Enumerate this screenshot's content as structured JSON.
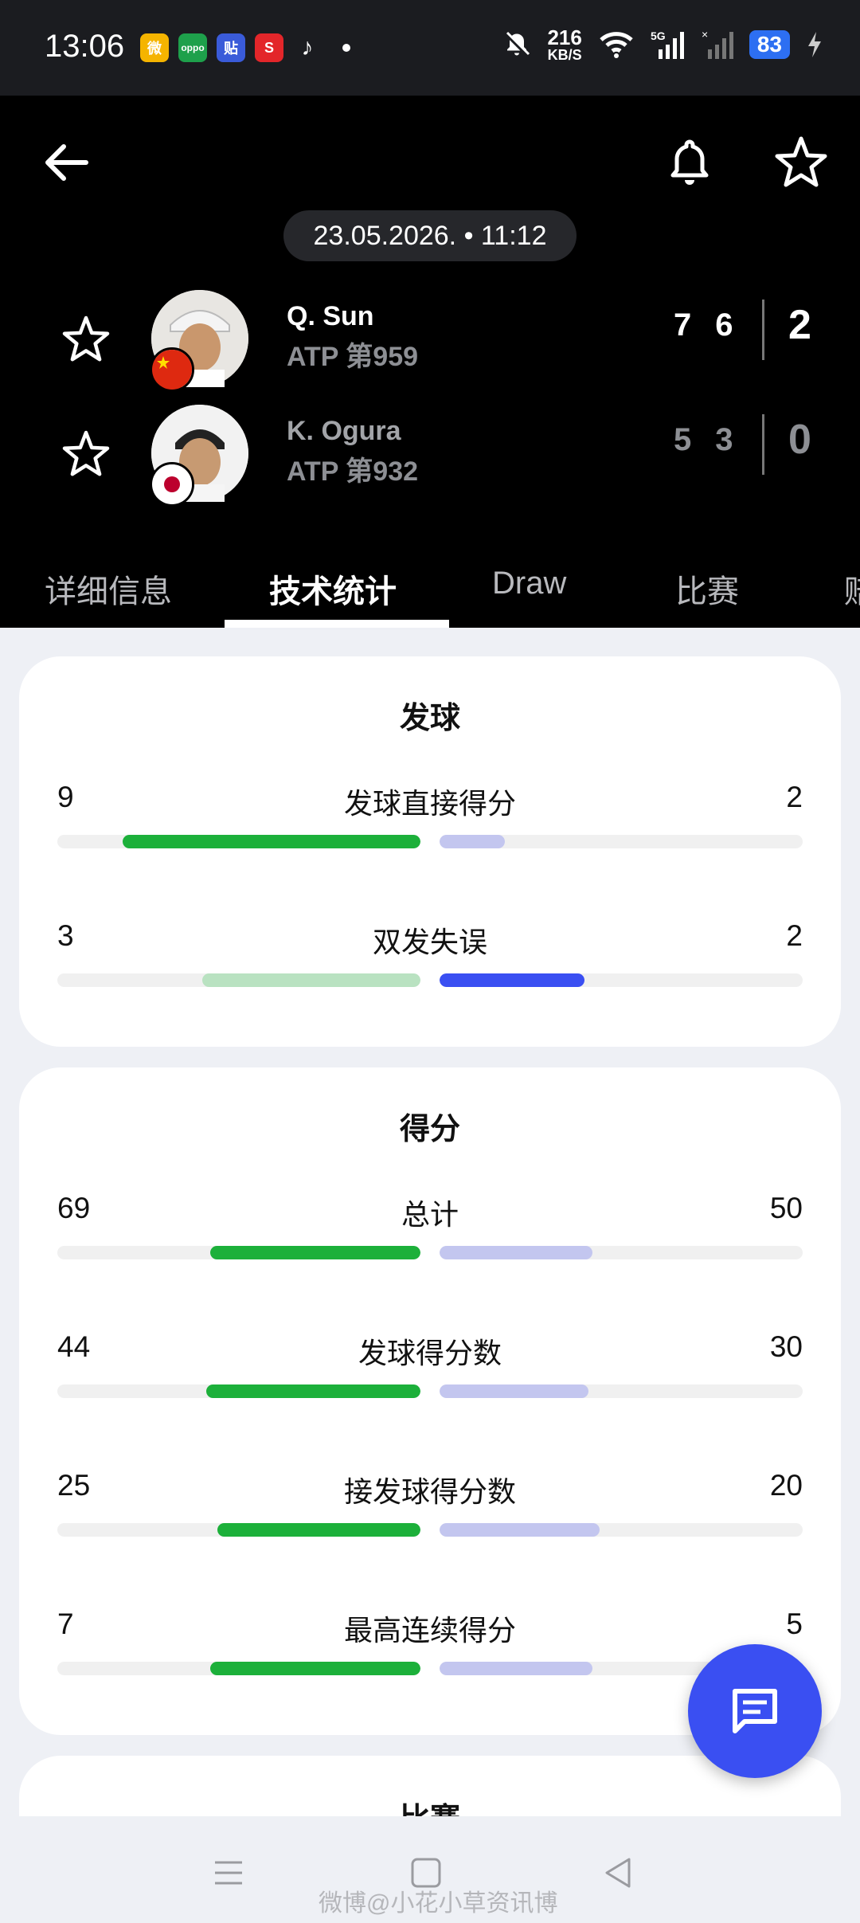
{
  "status_bar": {
    "time": "13:06",
    "speed_value": "216",
    "speed_unit": "KB/S",
    "network": "5G",
    "battery": "83",
    "apps": [
      "weibo-icon",
      "oppo-app-icon",
      "tieba-icon",
      "toutiao-icon",
      "tiktok-icon"
    ]
  },
  "header": {
    "datetime": "23.05.2026. • 11:12",
    "players": [
      {
        "name": "Q. Sun",
        "rank": "ATP 第959",
        "sets": [
          "7",
          "6"
        ],
        "total": "2",
        "flag": "china-flag-icon",
        "winner": true
      },
      {
        "name": "K. Ogura",
        "rank": "ATP 第932",
        "sets": [
          "5",
          "3"
        ],
        "total": "0",
        "flag": "japan-flag-icon",
        "winner": false
      }
    ],
    "tabs": [
      "详细信息",
      "技术统计",
      "Draw",
      "比赛",
      "赔"
    ],
    "active_tab": "技术统计"
  },
  "serve_card": {
    "title": "发球",
    "stats": [
      {
        "label": "发球直接得分",
        "left": "9",
        "right": "2",
        "left_pct": 82,
        "right_pct": 18,
        "left_color": "#1cb03a",
        "right_color": "#c3c6ef"
      },
      {
        "label": "双发失误",
        "left": "3",
        "right": "2",
        "left_pct": 60,
        "right_pct": 40,
        "left_color": "#b9e2c1",
        "right_color": "#3a4ff2"
      }
    ]
  },
  "points_card": {
    "title": "得分",
    "stats": [
      {
        "label": "总计",
        "left": "69",
        "right": "50",
        "left_pct": 58,
        "right_pct": 42,
        "left_color": "#1cb03a",
        "right_color": "#c3c6ef"
      },
      {
        "label": "发球得分数",
        "left": "44",
        "right": "30",
        "left_pct": 59,
        "right_pct": 41,
        "left_color": "#1cb03a",
        "right_color": "#c3c6ef"
      },
      {
        "label": "接发球得分数",
        "left": "25",
        "right": "20",
        "left_pct": 56,
        "right_pct": 44,
        "left_color": "#1cb03a",
        "right_color": "#c3c6ef"
      },
      {
        "label": "最高连续得分",
        "left": "7",
        "right": "5",
        "left_pct": 58,
        "right_pct": 42,
        "left_color": "#1cb03a",
        "right_color": "#c3c6ef"
      }
    ]
  },
  "match_card": {
    "title": "比赛"
  },
  "watermark": "微博@小花小草资讯博"
}
